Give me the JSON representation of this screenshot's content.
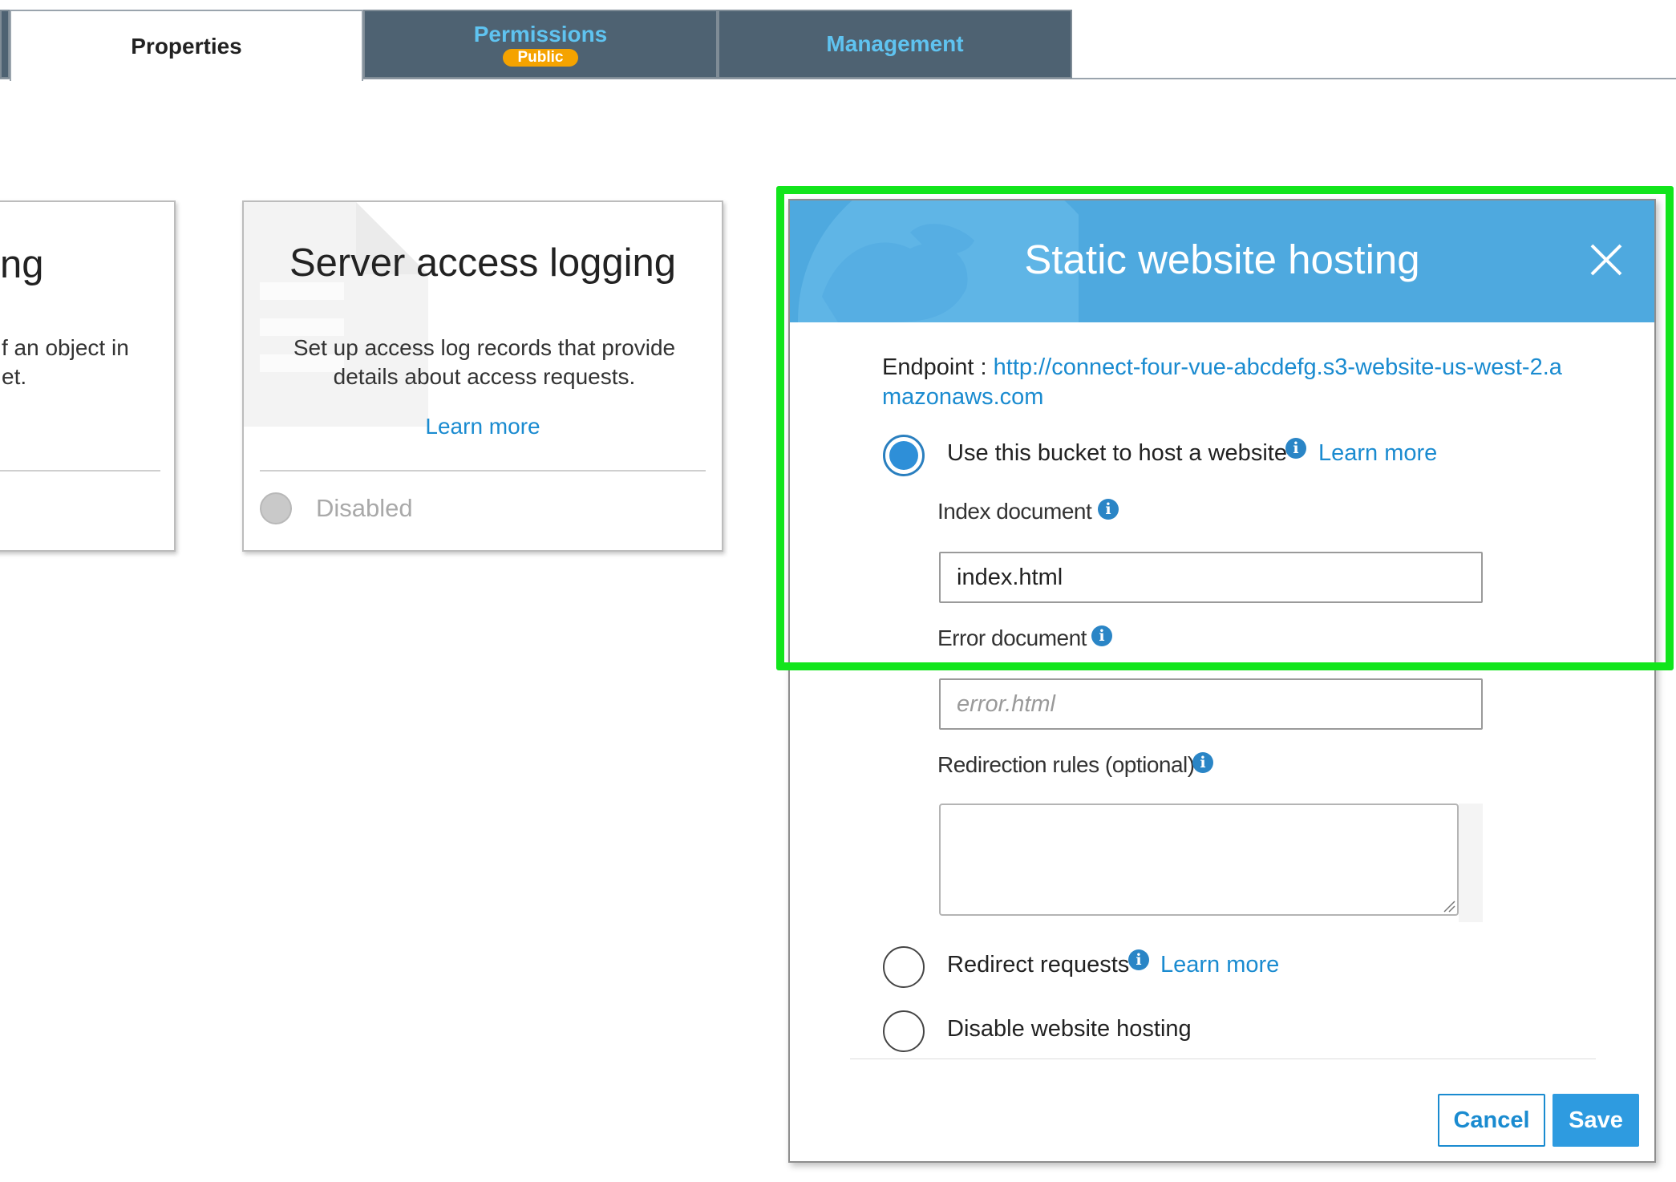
{
  "tabs": [
    {
      "label": "Properties",
      "active": true
    },
    {
      "label": "Permissions",
      "badge": "Public"
    },
    {
      "label": "Management"
    }
  ],
  "cards": {
    "partial": {
      "title_fragment": "ng",
      "desc_line1": "f an object in",
      "desc_line2": "et."
    },
    "server_access_logging": {
      "title": "Server access logging",
      "description": "Set up access log records that provide details about access requests.",
      "learn_more": "Learn more",
      "status": "Disabled"
    }
  },
  "modal": {
    "title": "Static website hosting",
    "endpoint_label": "Endpoint :",
    "endpoint_url": "http://connect-four-vue-abcdefg.s3-website-us-west-2.amazonaws.com",
    "options": {
      "host": {
        "label": "Use this bucket to host a website",
        "learn_more": "Learn more",
        "selected": true
      },
      "redirect": {
        "label": "Redirect requests",
        "learn_more": "Learn more",
        "selected": false
      },
      "disable": {
        "label": "Disable website hosting",
        "selected": false
      }
    },
    "index_document": {
      "label": "Index document",
      "value": "index.html"
    },
    "error_document": {
      "label": "Error document",
      "placeholder": "error.html"
    },
    "redirection_rules": {
      "label": "Redirection rules (optional)"
    },
    "cancel_label": "Cancel",
    "save_label": "Save"
  },
  "colors": {
    "accent": "#1a8bd0",
    "header_blue": "#4ea9df",
    "tab_dark": "#4e6272",
    "badge_orange": "#f5a300",
    "highlight_green": "#12e51c"
  },
  "icons": [
    "close-icon",
    "info-icon",
    "globe-icon",
    "document-icon",
    "resize-grip-icon"
  ]
}
